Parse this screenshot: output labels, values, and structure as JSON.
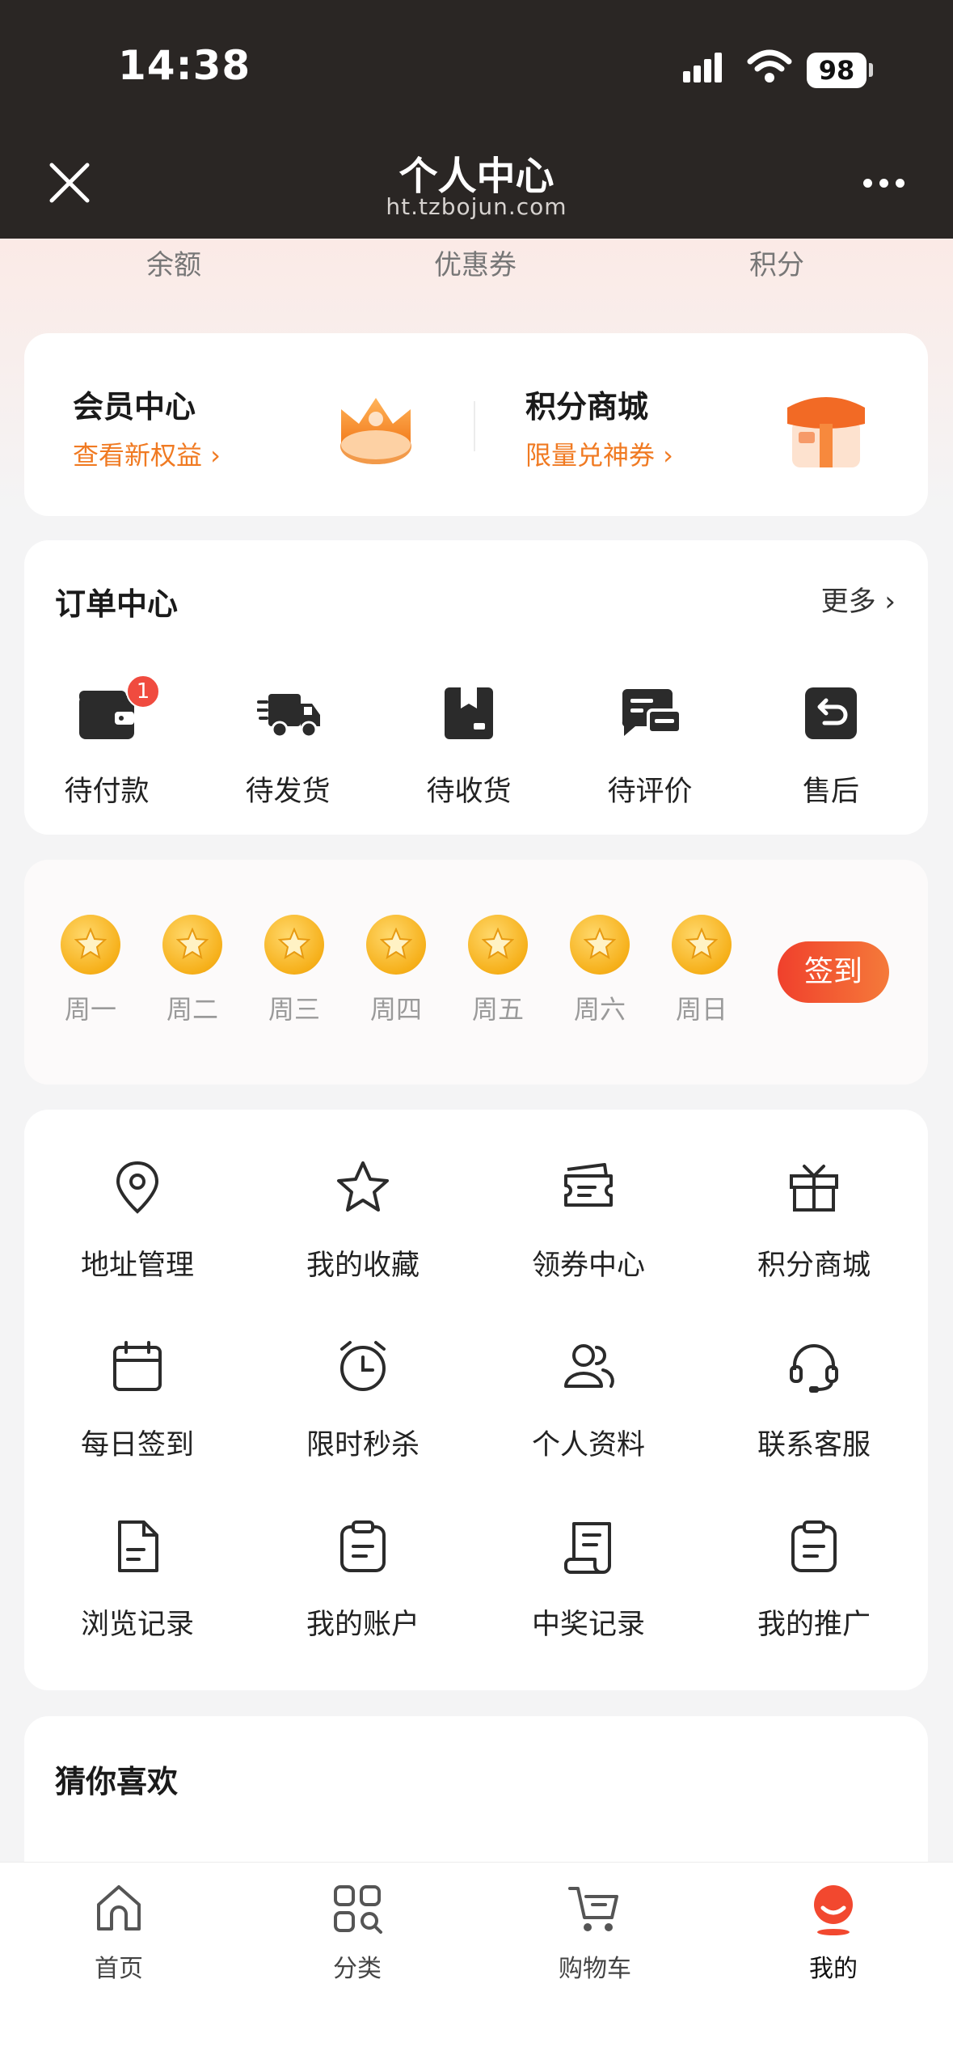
{
  "status_bar": {
    "time": "14:38",
    "battery": "98"
  },
  "nav": {
    "title": "个人中心",
    "url": "ht.tzbojun.com"
  },
  "assets": [
    "余额",
    "优惠券",
    "积分"
  ],
  "member": {
    "left": {
      "title": "会员中心",
      "link": "查看新权益 ›"
    },
    "right": {
      "title": "积分商城",
      "link": "限量兑神券 ›"
    }
  },
  "orders": {
    "title": "订单中心",
    "more": "更多 ›",
    "items": [
      {
        "label": "待付款",
        "badge": "1"
      },
      {
        "label": "待发货"
      },
      {
        "label": "待收货"
      },
      {
        "label": "待评价"
      },
      {
        "label": "售后"
      }
    ]
  },
  "signin": {
    "days": [
      "周一",
      "周二",
      "周三",
      "周四",
      "周五",
      "周六",
      "周日"
    ],
    "button": "签到"
  },
  "services": [
    "地址管理",
    "我的收藏",
    "领券中心",
    "积分商城",
    "每日签到",
    "限时秒杀",
    "个人资料",
    "联系客服",
    "浏览记录",
    "我的账户",
    "中奖记录",
    "我的推广"
  ],
  "recommend": {
    "title": "猜你喜欢"
  },
  "tabbar": {
    "items": [
      "首页",
      "分类",
      "购物车",
      "我的"
    ],
    "active": "我的"
  },
  "colors": {
    "accent": "#f07a22",
    "primary_red": "#f04b3f",
    "statusbar_bg": "#2a2624"
  }
}
